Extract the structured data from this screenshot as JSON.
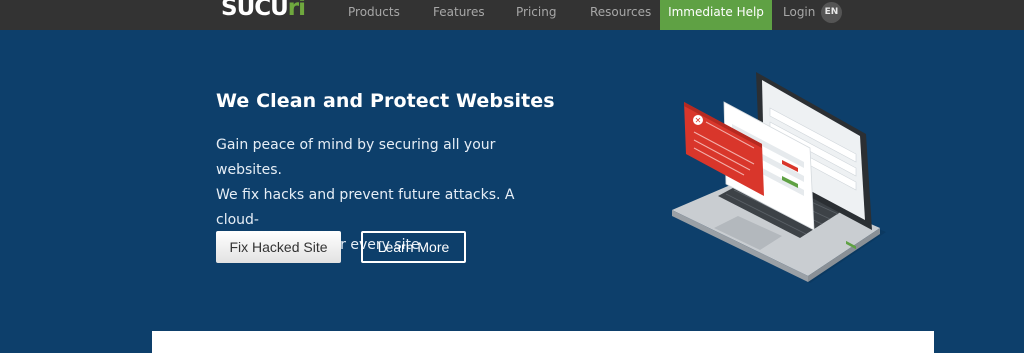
{
  "nav": {
    "logo": {
      "main": "SUCU",
      "accent": "ri"
    },
    "links": [
      "Products",
      "Features",
      "Pricing",
      "Resources"
    ],
    "cta": "Immediate Help",
    "login": "Login",
    "language": "EN"
  },
  "hero": {
    "title": "We Clean and Protect Websites",
    "description_lines": [
      "Gain peace of mind by securing all your websites.",
      "We fix hacks and prevent future attacks. A cloud-",
      "based platform for every site."
    ],
    "primary_button": "Fix Hacked Site",
    "secondary_button": "Learn More"
  },
  "colors": {
    "nav_bg": "#333333",
    "hero_bg": "#0d3f6b",
    "cta_green": "#5fa144",
    "alert_red": "#d9362b"
  },
  "icons": {
    "illustration": "laptop-dashboard-illustration",
    "warning": "warning-icon"
  }
}
